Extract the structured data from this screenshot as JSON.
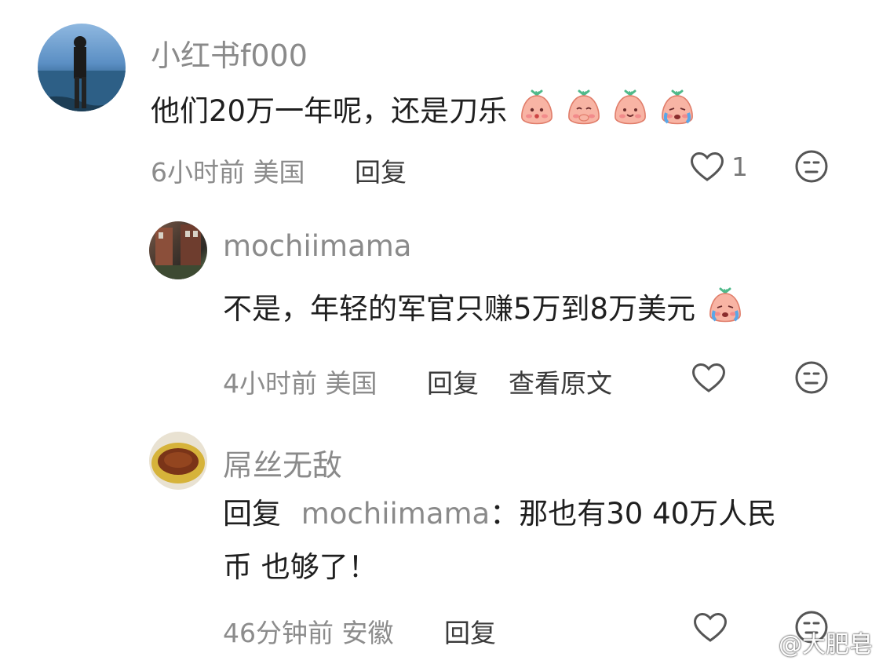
{
  "comments": [
    {
      "username": "小红书f000",
      "text": "他们20万一年呢，还是刀乐",
      "emojis": [
        "shy-mochi-emoji",
        "cover-mouth-mochi-emoji",
        "smile-mochi-emoji",
        "crying-mochi-emoji"
      ],
      "time": "6小时前",
      "location": "美国",
      "reply_label": "回复",
      "like_count": "1"
    },
    {
      "username": "mochiimama",
      "text": "不是，年轻的军官只赚5万到8万美元",
      "emojis": [
        "crying-mochi-emoji"
      ],
      "time": "4小时前",
      "location": "美国",
      "reply_label": "回复",
      "view_original_label": "查看原文"
    },
    {
      "username": "屌丝无敌",
      "reply_prefix": "回复",
      "mention": "mochiimama",
      "line1": "：那也有30 40万人民",
      "line2": "币 也够了！",
      "time": "46分钟前",
      "location": "安徽",
      "reply_label": "回复"
    }
  ],
  "watermark": "@大肥皂",
  "colors": {
    "text": "#1f1f1f",
    "muted": "#8a8a8a",
    "emoji_pink": "#f6a79a",
    "emoji_leaf": "#4fb98a"
  }
}
